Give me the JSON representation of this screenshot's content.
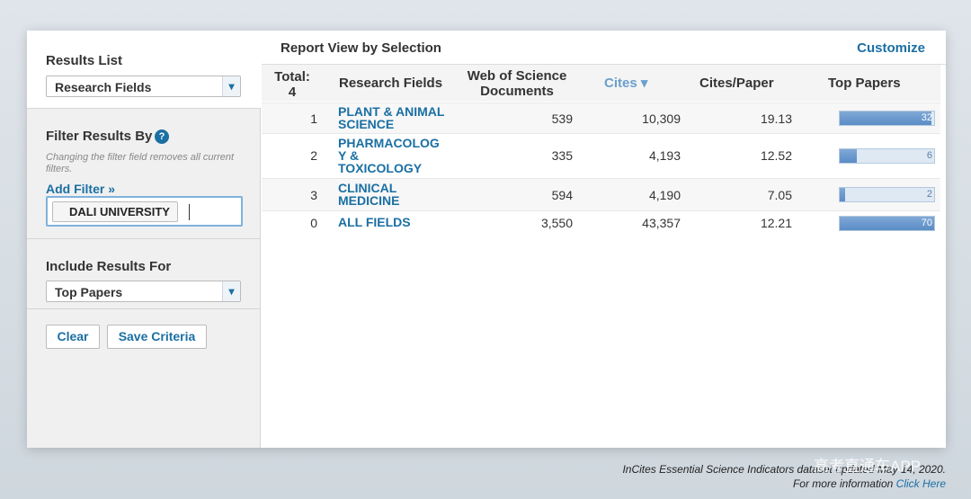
{
  "sidebar": {
    "results_title": "Results List",
    "results_select": "Research Fields",
    "filter_title": "Filter Results By",
    "help_glyph": "?",
    "filter_note": "Changing the filter field removes all current filters.",
    "add_filter": "Add Filter »",
    "filter_chip": "DALI UNIVERSITY",
    "include_title": "Include Results For",
    "include_select": "Top Papers",
    "clear_label": "Clear",
    "save_label": "Save Criteria"
  },
  "report": {
    "title": "Report View by Selection",
    "customize": "Customize",
    "headers": {
      "total": "Total:\n4",
      "field": "Research Fields",
      "wos": "Web of Science\nDocuments",
      "cites": "Cites ▾",
      "cpp": "Cites/Paper",
      "top": "Top Papers"
    },
    "rows": [
      {
        "rank": "1",
        "field": "PLANT & ANIMAL SCIENCE",
        "docs": "539",
        "cites": "10,309",
        "cpp": "19.13",
        "top": "32",
        "fill": 0.97
      },
      {
        "rank": "2",
        "field": "PHARMACOLOG\nY &\nTOXICOLOGY",
        "docs": "335",
        "cites": "4,193",
        "cpp": "12.52",
        "top": "6",
        "fill": 0.18
      },
      {
        "rank": "3",
        "field": "CLINICAL MEDICINE",
        "docs": "594",
        "cites": "4,190",
        "cpp": "7.05",
        "top": "2",
        "fill": 0.06
      },
      {
        "rank": "0",
        "field": "ALL FIELDS",
        "docs": "3,550",
        "cites": "43,357",
        "cpp": "12.21",
        "top": "70",
        "fill": 1.0
      }
    ]
  },
  "footer": {
    "line1": "InCites Essential Science Indicators dataset updated May 14, 2020.",
    "line2_prefix": "For more information ",
    "line2_link": "Click Here"
  },
  "watermark": "高考直通车APP",
  "colors": {
    "accent": "#1a6fa3",
    "bar": "#5b8cc6",
    "sort_header": "#6a9fcc"
  }
}
